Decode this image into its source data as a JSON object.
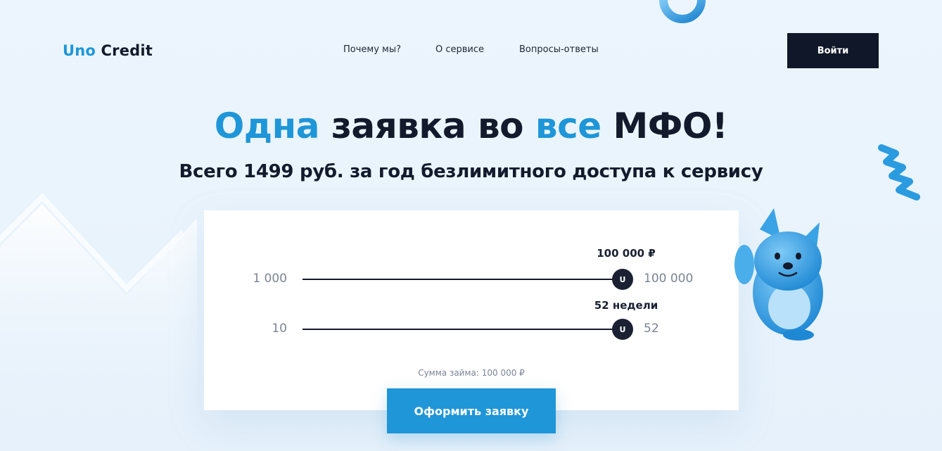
{
  "header": {
    "logo": {
      "part1": "Uno",
      "part2": "Credit"
    },
    "nav": [
      {
        "label": "Почему мы?"
      },
      {
        "label": "О сервисе"
      },
      {
        "label": "Вопросы-ответы"
      }
    ],
    "login_label": "Войти"
  },
  "hero": {
    "headline": {
      "w1": "Одна",
      "w2": "заявка во",
      "w3": "все",
      "w4": "МФО!"
    },
    "subheadline": "Всего 1499 руб. за год безлимитного доступа к сервису"
  },
  "calculator": {
    "amount": {
      "min": "1 000",
      "max": "100 000",
      "value": "100 000 ₽",
      "thumb_label": "U",
      "fraction": 1.0
    },
    "term": {
      "min": "10",
      "max": "52",
      "value": "52 недели",
      "thumb_label": "U",
      "fraction": 1.0
    },
    "loan_sum": "Сумма займа: 100 000 ₽",
    "submit_label": "Оформить заявку"
  },
  "colors": {
    "accent": "#1e96d8",
    "dark": "#0f1728",
    "background": "#eaf4fc"
  }
}
